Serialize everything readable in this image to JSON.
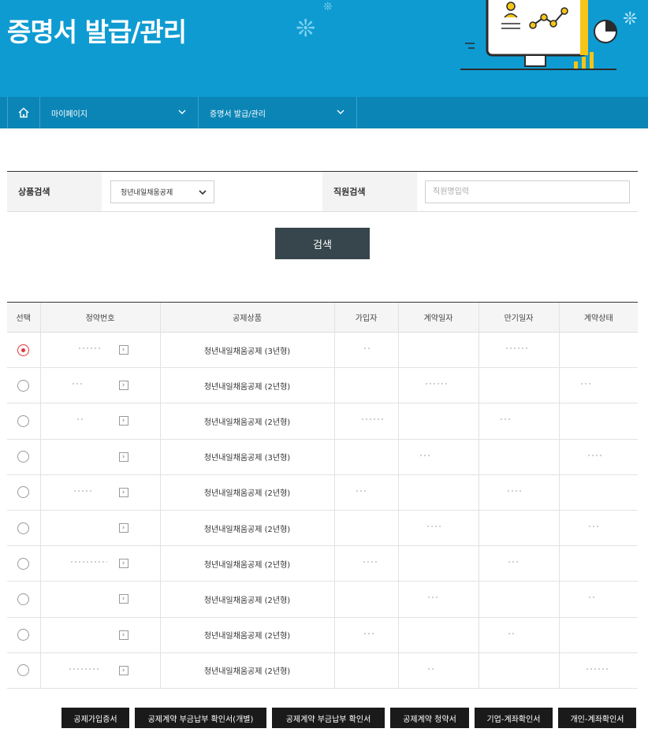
{
  "header": {
    "title": "증명서 발급/관리"
  },
  "nav": {
    "home_icon": "home-icon",
    "drop1": "마이페이지",
    "drop2": "증명서 발급/관리"
  },
  "search": {
    "product_label": "상품검색",
    "product_selected": "청년내일채움공제",
    "employee_label": "직원검색",
    "employee_placeholder": "직원명입력",
    "employee_value": "",
    "search_button": "검색"
  },
  "table": {
    "columns": [
      "선택",
      "청약번호",
      "공제상품",
      "가입자",
      "계약일자",
      "만기일자",
      "계약상태"
    ],
    "rows": [
      {
        "selected": true,
        "product": "청년내일채움공제 (3년형)"
      },
      {
        "selected": false,
        "product": "청년내일채움공제 (2년형)"
      },
      {
        "selected": false,
        "product": "청년내일채움공제 (2년형)"
      },
      {
        "selected": false,
        "product": "청년내일채움공제 (3년형)"
      },
      {
        "selected": false,
        "product": "청년내일채움공제 (2년형)"
      },
      {
        "selected": false,
        "product": "청년내일채움공제 (2년형)"
      },
      {
        "selected": false,
        "product": "청년내일채움공제 (2년형)"
      },
      {
        "selected": false,
        "product": "청년내일채움공제 (2년형)"
      },
      {
        "selected": false,
        "product": "청년내일채움공제 (2년형)"
      },
      {
        "selected": false,
        "product": "청년내일채움공제 (2년형)"
      }
    ]
  },
  "actions": [
    "공제가입증서",
    "공제계약 부금납부 확인서(개별)",
    "공제계약 부금납부 확인서",
    "공제계약 청약서",
    "기업-계좌확인서",
    "개인-계좌확인서"
  ],
  "colors": {
    "banner": "#0e9bd2",
    "nav": "#0b85b6",
    "search_button": "#37454c",
    "radio_selected": "#e5333a",
    "action_button": "#1a1a1a"
  }
}
